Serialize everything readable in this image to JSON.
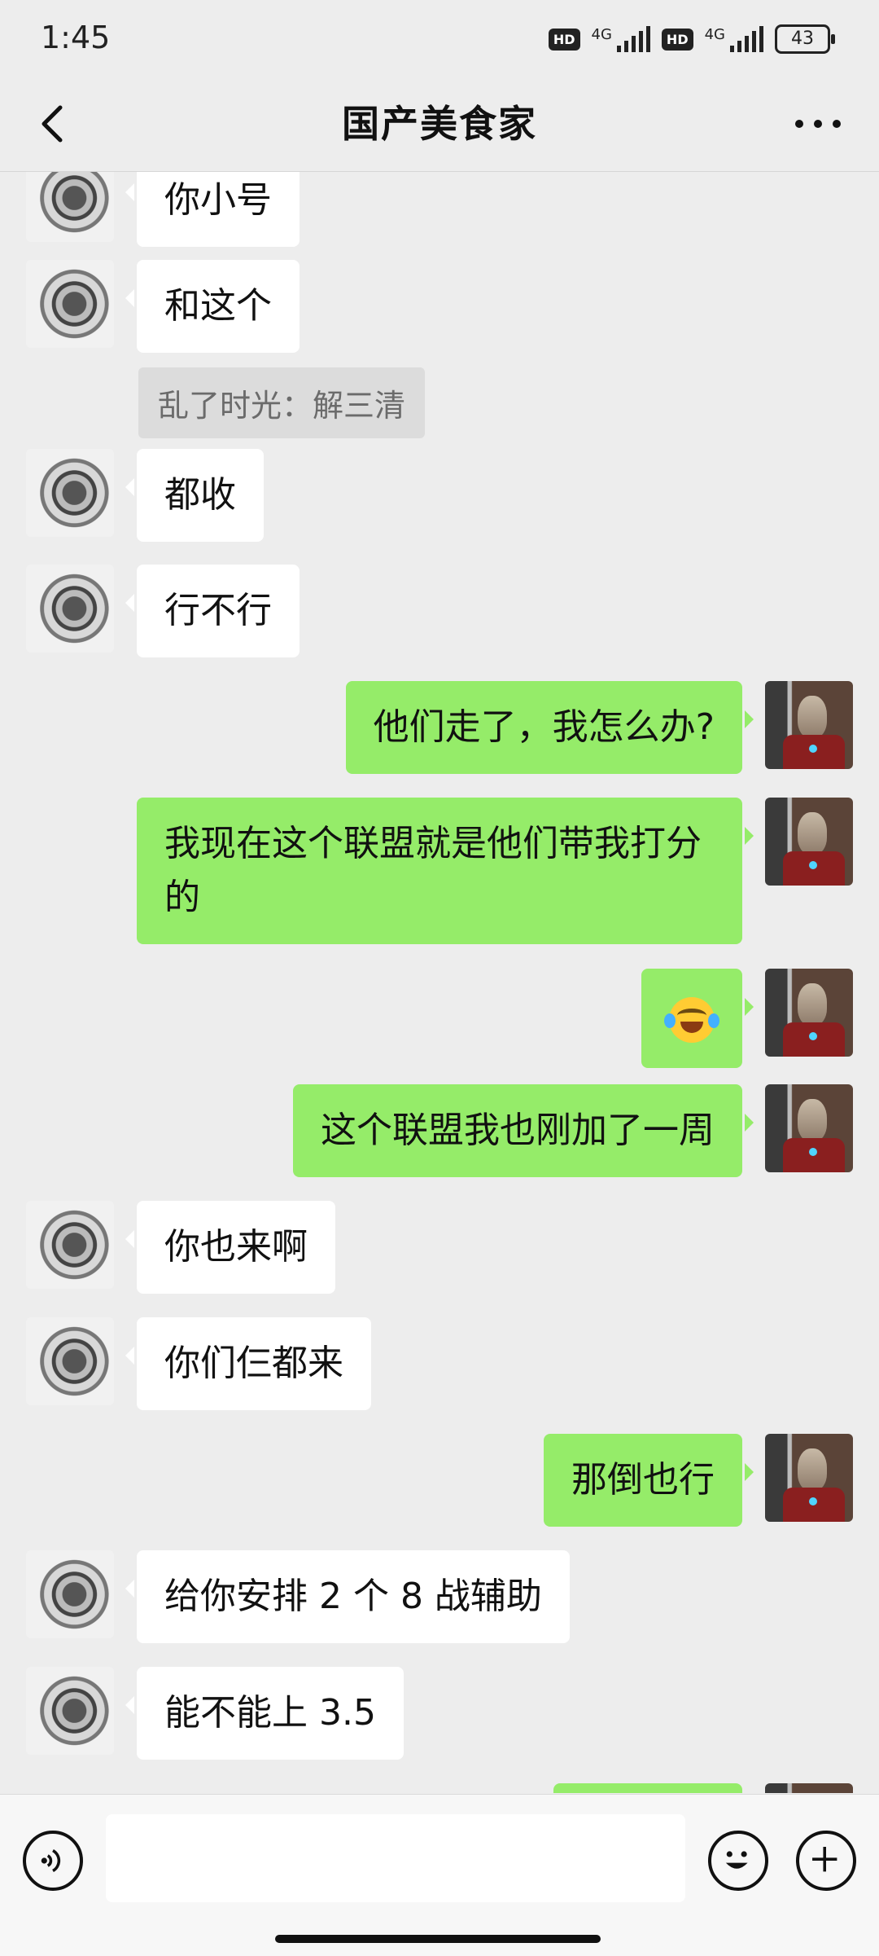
{
  "status_bar": {
    "time": "1:45",
    "hd1": "HD",
    "net1": "4G",
    "hd2": "HD",
    "net2": "4G",
    "battery": "43"
  },
  "header": {
    "title": "国产美食家",
    "back_icon": "chevron-left-icon",
    "more_icon": "more-dots-icon"
  },
  "messages": [
    {
      "side": "left",
      "text": "你小号"
    },
    {
      "side": "left",
      "text": "和这个",
      "quote": "乱了时光：解三清"
    },
    {
      "side": "left",
      "text": "都收"
    },
    {
      "side": "left",
      "text": "行不行"
    },
    {
      "side": "right",
      "text": "他们走了，我怎么办?"
    },
    {
      "side": "right",
      "text": "我现在这个联盟就是他们带我打分的"
    },
    {
      "side": "right",
      "text": "",
      "emoji": "laughing-crying-emoji"
    },
    {
      "side": "right",
      "text": "这个联盟我也刚加了一周"
    },
    {
      "side": "left",
      "text": "你也来啊"
    },
    {
      "side": "left",
      "text": "你们仨都来"
    },
    {
      "side": "right",
      "text": "那倒也行"
    },
    {
      "side": "left",
      "text": "给你安排 2 个 8 战辅助"
    },
    {
      "side": "left",
      "text": "能不能上 3.5"
    }
  ],
  "input_bar": {
    "voice_icon": "voice-icon",
    "emoji_icon": "emoji-icon",
    "plus_icon": "plus-icon",
    "field_value": ""
  },
  "colors": {
    "background": "#ededed",
    "bubble_left": "#ffffff",
    "bubble_right": "#95ec69",
    "quote_bg": "#dcdcdc"
  }
}
